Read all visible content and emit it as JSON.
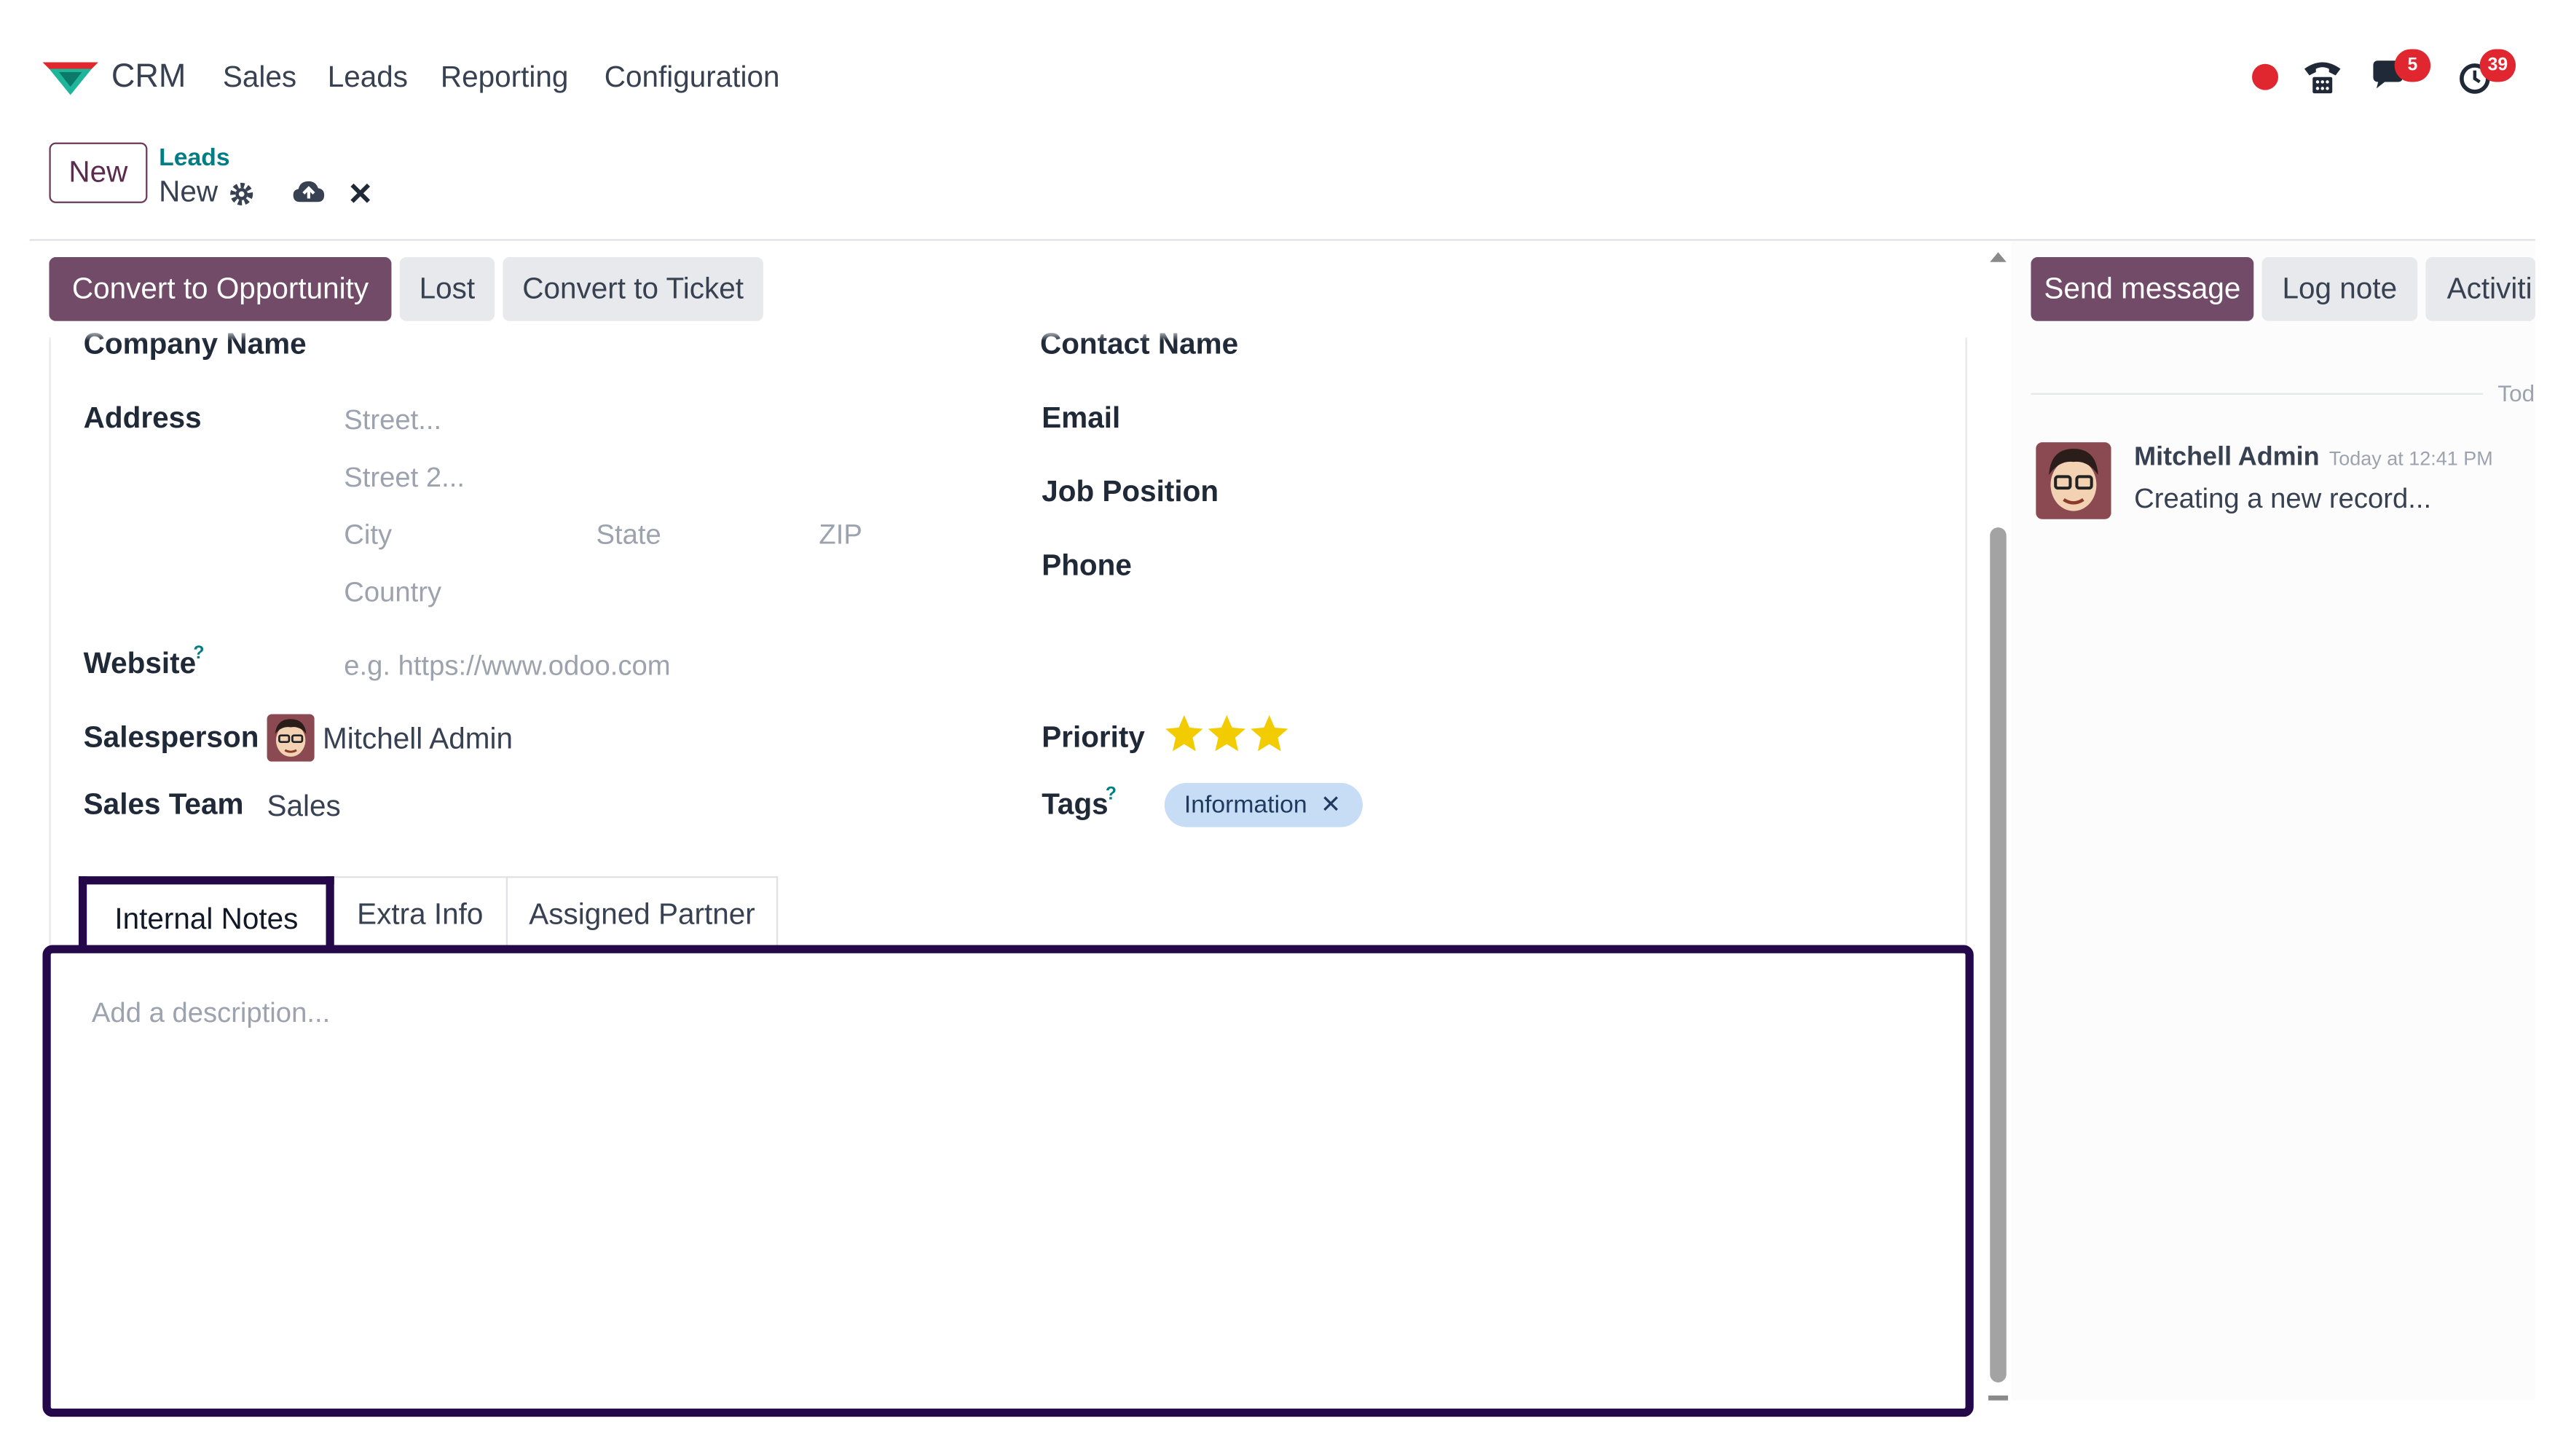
{
  "nav": {
    "app_name": "CRM",
    "menus": [
      "Sales",
      "Leads",
      "Reporting",
      "Configuration"
    ],
    "messages_badge": "5",
    "activities_badge": "39"
  },
  "breadcrumb": {
    "new_button": "New",
    "parent": "Leads",
    "current": "New"
  },
  "statusbar": {
    "convert_opportunity": "Convert to Opportunity",
    "lost": "Lost",
    "convert_ticket": "Convert to Ticket"
  },
  "form": {
    "company_name_label": "Company Name",
    "contact_name_label": "Contact Name",
    "address_label": "Address",
    "street_ph": "Street...",
    "street2_ph": "Street 2...",
    "city_ph": "City",
    "state_ph": "State",
    "zip_ph": "ZIP",
    "country_ph": "Country",
    "email_label": "Email",
    "job_position_label": "Job Position",
    "phone_label": "Phone",
    "website_label": "Website",
    "website_ph": "e.g. https://www.odoo.com",
    "help_mark": "?",
    "salesperson_label": "Salesperson",
    "salesperson_value": "Mitchell Admin",
    "sales_team_label": "Sales Team",
    "sales_team_value": "Sales",
    "priority_label": "Priority",
    "priority_stars": 3,
    "priority_max": 3,
    "tags_label": "Tags",
    "tag_value": "Information",
    "tag_remove": "✕"
  },
  "tabs": {
    "internal_notes": "Internal Notes",
    "extra_info": "Extra Info",
    "assigned_partner": "Assigned Partner",
    "description_ph": "Add a description..."
  },
  "chatter": {
    "send_message": "Send message",
    "log_note": "Log note",
    "activities": "Activiti",
    "today": "Tod",
    "author": "Mitchell Admin",
    "time": "Today at 12:41 PM",
    "body": "Creating a new record..."
  },
  "colors": {
    "primary": "#714b67",
    "link": "#017e84",
    "highlight_border": "#24084a",
    "star": "#f3cc00",
    "tag_bg": "#c7dcf5",
    "badge": "#e0262e"
  }
}
